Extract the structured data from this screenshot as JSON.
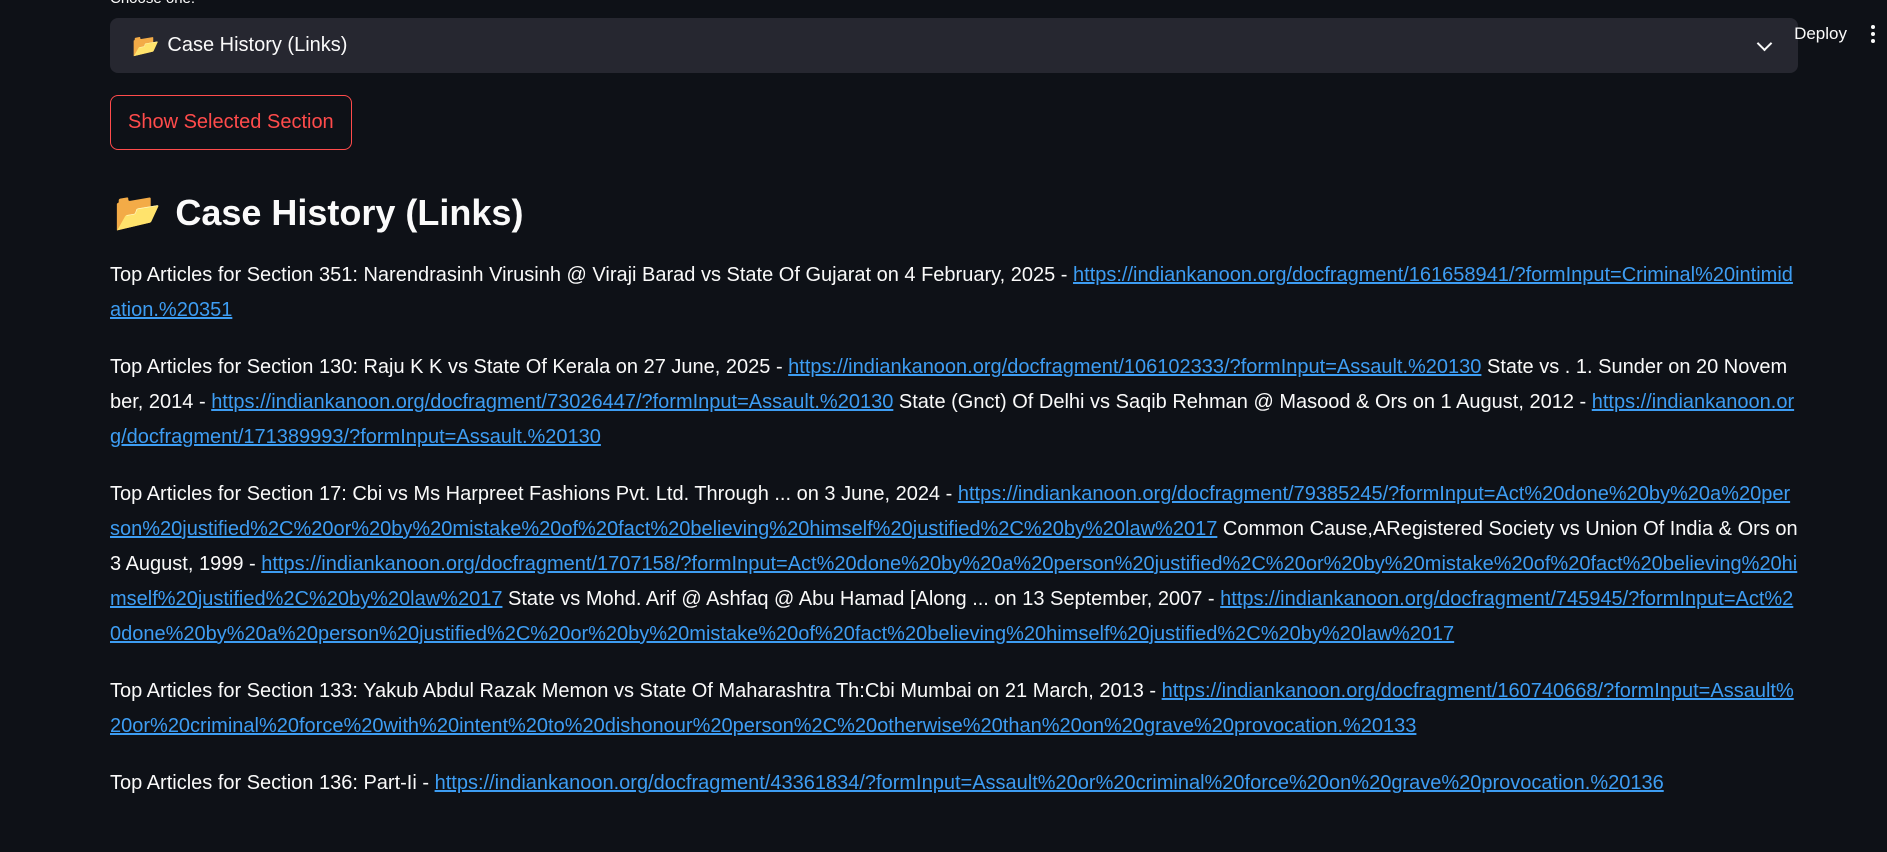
{
  "toolbar": {
    "deploy_label": "Deploy",
    "menu_icon": "kebab-menu-icon"
  },
  "select": {
    "label": "Choose one:",
    "value_icon": "📂",
    "value": "Case History (Links)",
    "icon": "chevron-down-icon"
  },
  "button": {
    "label": "Show Selected Section",
    "color": "#ff4b4b"
  },
  "section": {
    "icon": "📂",
    "title": "Case History (Links)"
  },
  "colors": {
    "background": "#0e1117",
    "select_bg": "#262730",
    "link": "#3d9df3",
    "accent": "#ff4b4b"
  },
  "articles": [
    {
      "parts": [
        {
          "text": "Top Articles for Section 351: Narendrasinh Virusinh @ Viraji Barad vs State Of Gujarat on 4 February, 2025 - "
        },
        {
          "link": "https://indiankanoon.org/docfragment/161658941/?formInput=Criminal%20intimidation.%20351"
        }
      ]
    },
    {
      "parts": [
        {
          "text": "Top Articles for Section 130: Raju K K vs State Of Kerala on 27 June, 2025 - "
        },
        {
          "link": "https://indiankanoon.org/docfragment/106102333/?formInput=Assault.%20130"
        },
        {
          "text": " State vs . 1. Sunder on 20 November, 2014 - "
        },
        {
          "link": "https://indiankanoon.org/docfragment/73026447/?formInput=Assault.%20130"
        },
        {
          "text": " State (Gnct) Of Delhi vs Saqib Rehman @ Masood & Ors on 1 August, 2012 - "
        },
        {
          "link": "https://indiankanoon.org/docfragment/171389993/?formInput=Assault.%20130"
        }
      ]
    },
    {
      "parts": [
        {
          "text": "Top Articles for Section 17: Cbi vs Ms Harpreet Fashions Pvt. Ltd. Through ... on 3 June, 2024 - "
        },
        {
          "link": "https://indiankanoon.org/docfragment/79385245/?formInput=Act%20done%20by%20a%20person%20justified%2C%20or%20by%20mistake%20of%20fact%20believing%20himself%20justified%2C%20by%20law%2017"
        },
        {
          "text": " Common Cause,ARegistered Society vs Union Of India & Ors on 3 August, 1999 - "
        },
        {
          "link": "https://indiankanoon.org/docfragment/1707158/?formInput=Act%20done%20by%20a%20person%20justified%2C%20or%20by%20mistake%20of%20fact%20believing%20himself%20justified%2C%20by%20law%2017"
        },
        {
          "text": " State vs Mohd. Arif @ Ashfaq @ Abu Hamad [Along ... on 13 September, 2007 - "
        },
        {
          "link": "https://indiankanoon.org/docfragment/745945/?formInput=Act%20done%20by%20a%20person%20justified%2C%20or%20by%20mistake%20of%20fact%20believing%20himself%20justified%2C%20by%20law%2017"
        }
      ]
    },
    {
      "parts": [
        {
          "text": "Top Articles for Section 133: Yakub Abdul Razak Memon vs State Of Maharashtra Th:Cbi Mumbai on 21 March, 2013 - "
        },
        {
          "link": "https://indiankanoon.org/docfragment/160740668/?formInput=Assault%20or%20criminal%20force%20with%20intent%20to%20dishonour%20person%2C%20otherwise%20than%20on%20grave%20provocation.%20133"
        }
      ]
    },
    {
      "parts": [
        {
          "text": "Top Articles for Section 136: Part-Ii - "
        },
        {
          "link": "https://indiankanoon.org/docfragment/43361834/?formInput=Assault%20or%20criminal%20force%20on%20grave%20provocation.%20136"
        }
      ]
    }
  ]
}
